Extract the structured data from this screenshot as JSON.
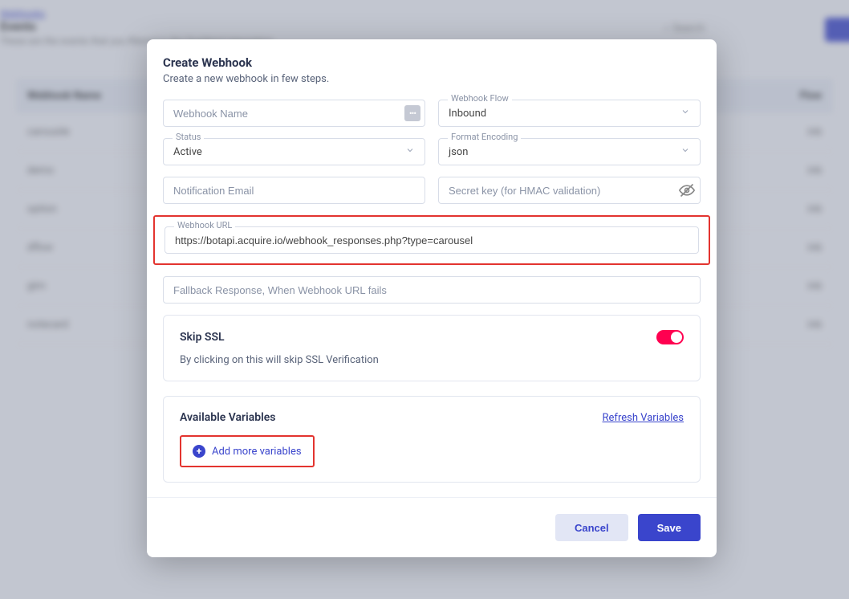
{
  "bg": {
    "title_link": "Webhooks",
    "title_line1": "Events",
    "title_line2": "These are the events that you filtered in the Dashbird integration.",
    "search": "Search",
    "table_head": "Webhook Name",
    "table_head_right": "Flow",
    "rows": [
      "carousile",
      "demo",
      "option",
      "dflow",
      "gtm",
      "notecard"
    ],
    "row_right": "inb"
  },
  "modal": {
    "title": "Create Webhook",
    "subtitle": "Create a new webhook in few steps.",
    "webhook_name_placeholder": "Webhook Name",
    "status_label": "Status",
    "status_value": "Active",
    "flow_label": "Webhook Flow",
    "flow_value": "Inbound",
    "format_label": "Format Encoding",
    "format_value": "json",
    "notification_email_placeholder": "Notification Email",
    "secret_key_placeholder": "Secret key (for HMAC validation)",
    "url_label": "Webhook URL",
    "url_value": "https://botapi.acquire.io/webhook_responses.php?type=carousel",
    "fallback_placeholder": "Fallback Response, When Webhook URL fails",
    "skip_ssl_title": "Skip SSL",
    "skip_ssl_desc": "By clicking on this will skip SSL Verification",
    "skip_ssl_on": true,
    "vars_title": "Available Variables",
    "refresh": "Refresh Variables",
    "add_vars": "Add more variables",
    "cancel": "Cancel",
    "save": "Save"
  }
}
